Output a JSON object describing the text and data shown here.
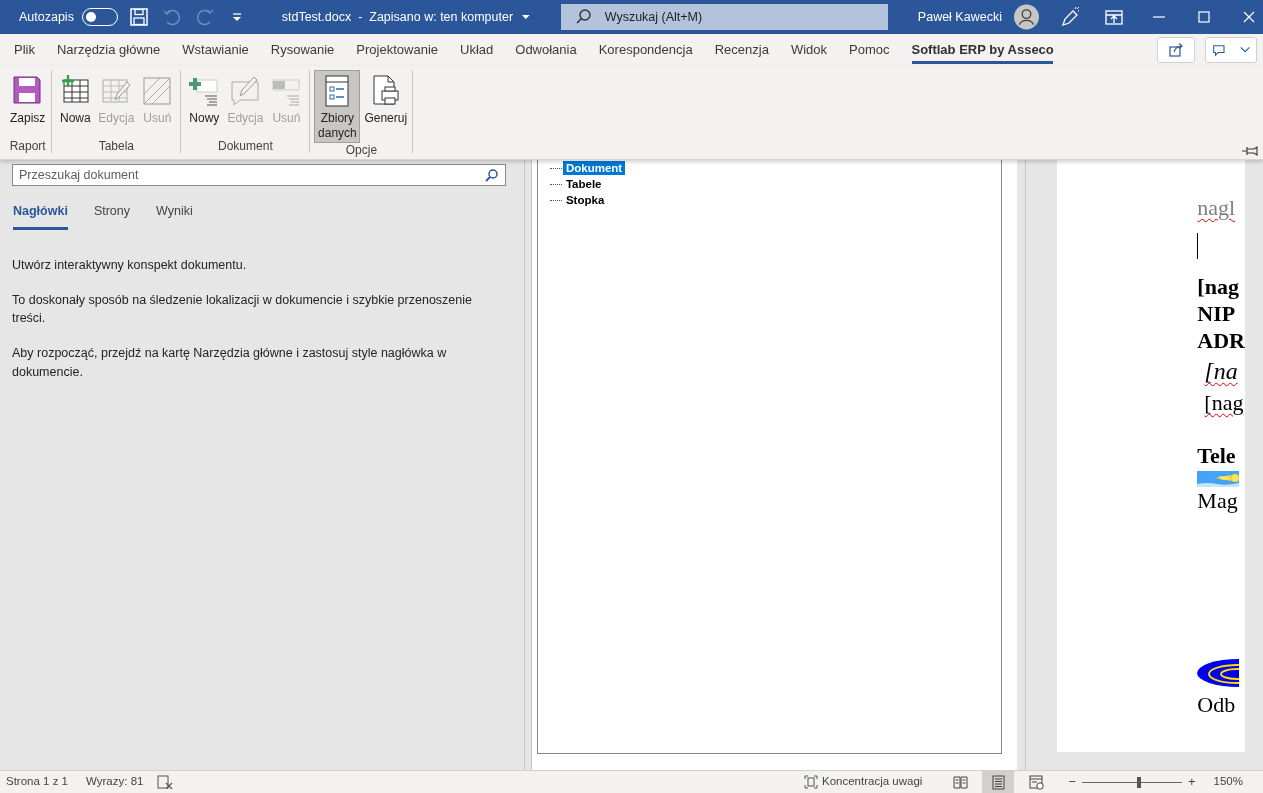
{
  "title_bar": {
    "autosave_label": "Autozapis",
    "autosave_on": false,
    "document_title": "stdTest.docx  -  Zapisano w: ten komputer",
    "search_placeholder": "Wyszukaj (Alt+M)",
    "user_name": "Paweł Kawecki",
    "quick_access": [
      {
        "kind": "save",
        "disabled": false
      },
      {
        "kind": "undo",
        "disabled": true
      },
      {
        "kind": "redo",
        "disabled": true
      },
      {
        "kind": "customize",
        "disabled": false
      }
    ]
  },
  "ribbon_tabs": [
    {
      "label": "Plik",
      "selected": false
    },
    {
      "label": "Narzędzia główne",
      "selected": false
    },
    {
      "label": "Wstawianie",
      "selected": false
    },
    {
      "label": "Rysowanie",
      "selected": false
    },
    {
      "label": "Projektowanie",
      "selected": false
    },
    {
      "label": "Układ",
      "selected": false
    },
    {
      "label": "Odwołania",
      "selected": false
    },
    {
      "label": "Korespondencja",
      "selected": false
    },
    {
      "label": "Recenzja",
      "selected": false
    },
    {
      "label": "Widok",
      "selected": false
    },
    {
      "label": "Pomoc",
      "selected": false
    },
    {
      "label": "Softlab ERP by Asseco",
      "selected": true
    }
  ],
  "ribbon_groups": [
    {
      "label": "Raport",
      "buttons": [
        {
          "label": "Zapisz",
          "kind": "save",
          "disabled": false,
          "pressed": false
        }
      ]
    },
    {
      "label": "Tabela",
      "buttons": [
        {
          "label": "Nowa",
          "kind": "table-new",
          "disabled": false,
          "pressed": false
        },
        {
          "label": "Edycja",
          "kind": "table-edit",
          "disabled": true,
          "pressed": false
        },
        {
          "label": "Usuń",
          "kind": "table-delete",
          "disabled": true,
          "pressed": false
        }
      ]
    },
    {
      "label": "Dokument",
      "buttons": [
        {
          "label": "Nowy",
          "kind": "doc-new",
          "disabled": false,
          "pressed": false
        },
        {
          "label": "Edycja",
          "kind": "doc-edit",
          "disabled": true,
          "pressed": false
        },
        {
          "label": "Usuń",
          "kind": "doc-delete",
          "disabled": true,
          "pressed": false
        }
      ]
    },
    {
      "label": "Opcje",
      "buttons": [
        {
          "label": "Zbiory danych",
          "kind": "datasets",
          "disabled": false,
          "pressed": true
        },
        {
          "label": "Generuj",
          "kind": "generate",
          "disabled": false,
          "pressed": false
        }
      ]
    }
  ],
  "navigation_pane": {
    "search_placeholder": "Przeszukaj dokument",
    "tabs": [
      {
        "label": "Nagłówki",
        "selected": true
      },
      {
        "label": "Strony",
        "selected": false
      },
      {
        "label": "Wyniki",
        "selected": false
      }
    ],
    "messages": [
      "Utwórz interaktywny konspekt dokumentu.",
      "To doskonały sposób na śledzenie lokalizacji w dokumencie i szybkie przenoszenie treści.",
      "Aby rozpocząć, przejdź na kartę Narzędzia główne i zastosuj style nagłówka w dokumencie."
    ]
  },
  "tree": {
    "items": [
      {
        "label": "Dokument",
        "selected": true
      },
      {
        "label": "Tabele",
        "selected": false
      },
      {
        "label": "Stopka",
        "selected": false
      }
    ]
  },
  "document": {
    "blocks": [
      {
        "kind": "grey",
        "text": "nagl",
        "misspelled": true
      },
      {
        "kind": "cursor"
      },
      {
        "kind": "bold",
        "text": "[nag",
        "misspelled": false
      },
      {
        "kind": "bold",
        "text": "NIP",
        "misspelled": false
      },
      {
        "kind": "bold",
        "text": "ADR",
        "misspelled": false
      },
      {
        "kind": "italic",
        "text": "[na",
        "misspelled": true
      },
      {
        "kind": "indented",
        "text": "[nag",
        "misspelled": true
      },
      {
        "kind": "bold-spaced",
        "text": "Tele",
        "misspelled": false
      },
      {
        "kind": "picture"
      },
      {
        "kind": "regular",
        "text": "Mag",
        "misspelled": false
      },
      {
        "kind": "logo"
      },
      {
        "kind": "regular",
        "text": "Odb",
        "misspelled": false
      }
    ]
  },
  "status_bar": {
    "page": "Strona 1 z 1",
    "words": "Wyrazy: 81",
    "focus": "Koncentracja uwagi",
    "views": [
      {
        "kind": "read",
        "selected": false
      },
      {
        "kind": "print",
        "selected": true
      },
      {
        "kind": "web",
        "selected": false
      }
    ],
    "zoom": {
      "minus": "−",
      "plus": "+",
      "level": 0.57,
      "reading": "150%"
    }
  }
}
